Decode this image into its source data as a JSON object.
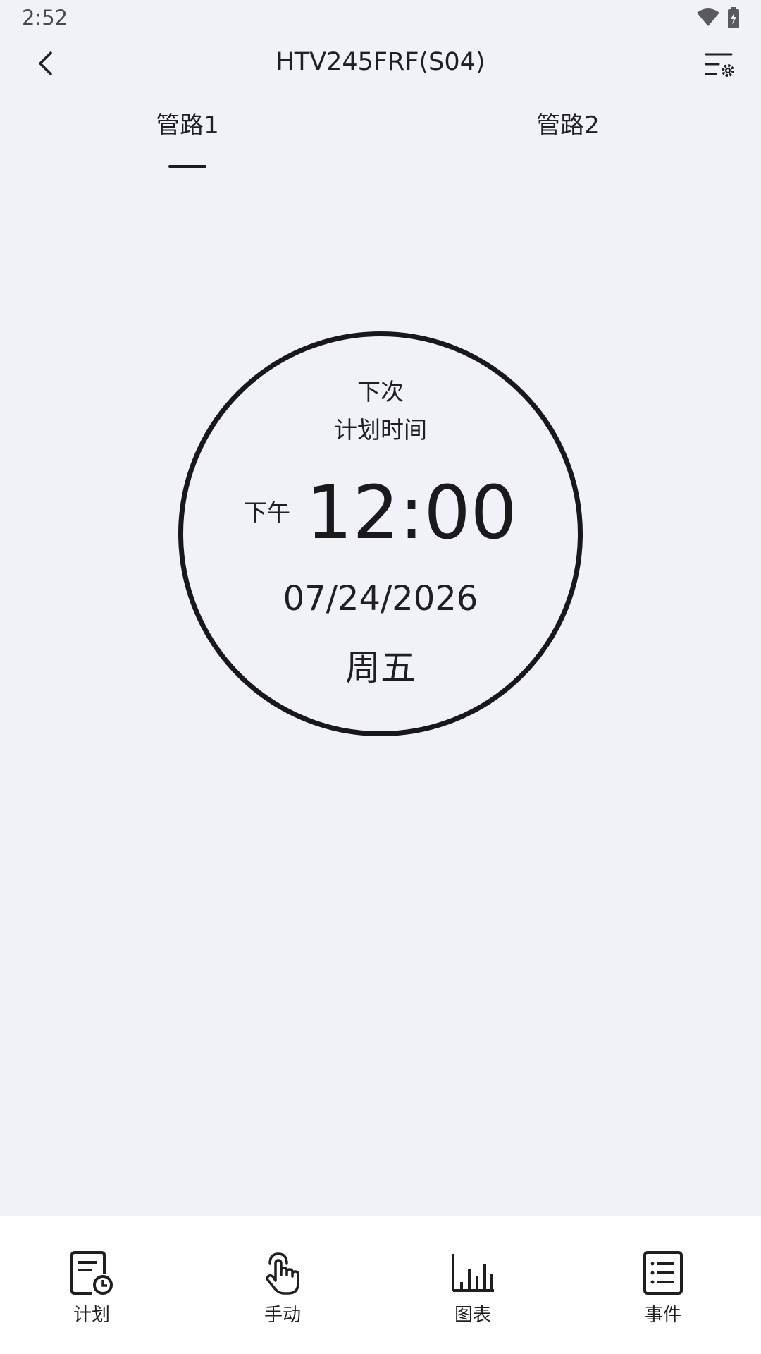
{
  "status_bar": {
    "time": "2:52"
  },
  "header": {
    "title": "HTV245FRF(S04)"
  },
  "tabs": [
    {
      "label": "管路1",
      "active": true
    },
    {
      "label": "管路2",
      "active": false
    }
  ],
  "schedule": {
    "label_line1": "下次",
    "label_line2": "计划时间",
    "ampm": "下午",
    "time": "12:00",
    "date": "07/24/2026",
    "weekday": "周五"
  },
  "bottom_nav": [
    {
      "label": "计划",
      "icon": "schedule-doc-clock-icon"
    },
    {
      "label": "手动",
      "icon": "hand-tap-icon"
    },
    {
      "label": "图表",
      "icon": "bar-chart-icon"
    },
    {
      "label": "事件",
      "icon": "event-list-icon"
    }
  ],
  "colors": {
    "background": "#f1f2f7",
    "nav_background": "#ffffff",
    "accent": "#1c1c1e"
  }
}
